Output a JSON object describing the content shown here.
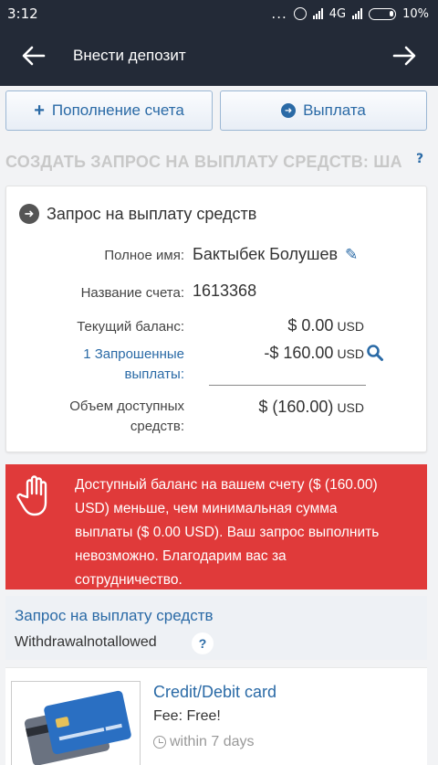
{
  "statusbar": {
    "time": "3:12",
    "dots": "...",
    "network": "4G",
    "battery": "10%"
  },
  "appbar": {
    "title": "Внести депозит",
    "back_icon": "arrow-left-icon",
    "forward_icon": "arrow-right-icon"
  },
  "tabs": {
    "deposit_label": "Пополнение счета",
    "payout_label": "Выплата"
  },
  "section": {
    "title": "СОЗДАТЬ ЗАПРОС НА ВЫПЛАТУ СРЕДСТВ: ША",
    "help": "?"
  },
  "card": {
    "title": "Запрос на выплату средств",
    "full_name_label": "Полное имя:",
    "full_name": "Бактыбек Болушев",
    "account_label": "Название счета:",
    "account": "1613368",
    "balance_label": "Текущий баланс:",
    "balance": "$ 0.00",
    "balance_cur": "USD",
    "requested_label_1": "1 Запрошенные",
    "requested_label_2": "выплаты:",
    "requested": "-$ 160.00",
    "requested_cur": "USD",
    "available_label_1": "Объем доступных",
    "available_label_2": "средств:",
    "available": "$ (160.00)",
    "available_cur": "USD"
  },
  "error": {
    "line1": "Доступный баланс на вашем счету ($ (160.00)",
    "line2": "USD) меньше, чем минимальная сумма",
    "line3": "выплаты ($ 0.00 USD). Ваш запрос выполнить",
    "line4": "невозможно. Благодарим вас за",
    "line5": "сотрудничество."
  },
  "panel": {
    "title": "Запрос на выплату средств",
    "value": "Withdrawalnotallowed",
    "help": "?"
  },
  "payment": {
    "name": "Credit/Debit card",
    "fee": "Fee: Free!",
    "time": "within 7 days"
  },
  "colors": {
    "appbar": "#232a37",
    "accent": "#2a6aa6",
    "error": "#e03a3a"
  }
}
